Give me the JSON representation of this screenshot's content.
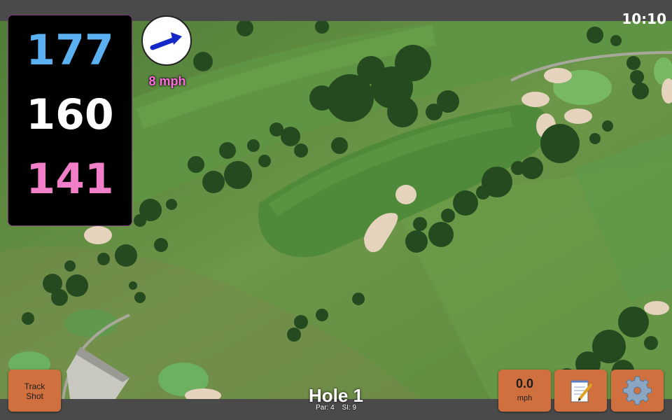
{
  "status": {
    "time": "10:10"
  },
  "distances": {
    "back": "177",
    "center": "160",
    "front": "141"
  },
  "wind": {
    "speed": "8 mph",
    "direction_icon": "wind-arrow-icon"
  },
  "hole": {
    "title": "Hole 1",
    "par": "Par: 4",
    "si": "SI: 9"
  },
  "buttons": {
    "track_line1": "Track",
    "track_line2": "Shot",
    "speed_value": "0.0",
    "speed_unit": "mph",
    "notes_icon": "notepad-icon",
    "settings_icon": "gear-icon"
  },
  "colors": {
    "back": "#5ab0f0",
    "center": "#ffffff",
    "front": "#f07ec8",
    "wind_text": "#ff6ae0",
    "button": "#d0703f"
  }
}
